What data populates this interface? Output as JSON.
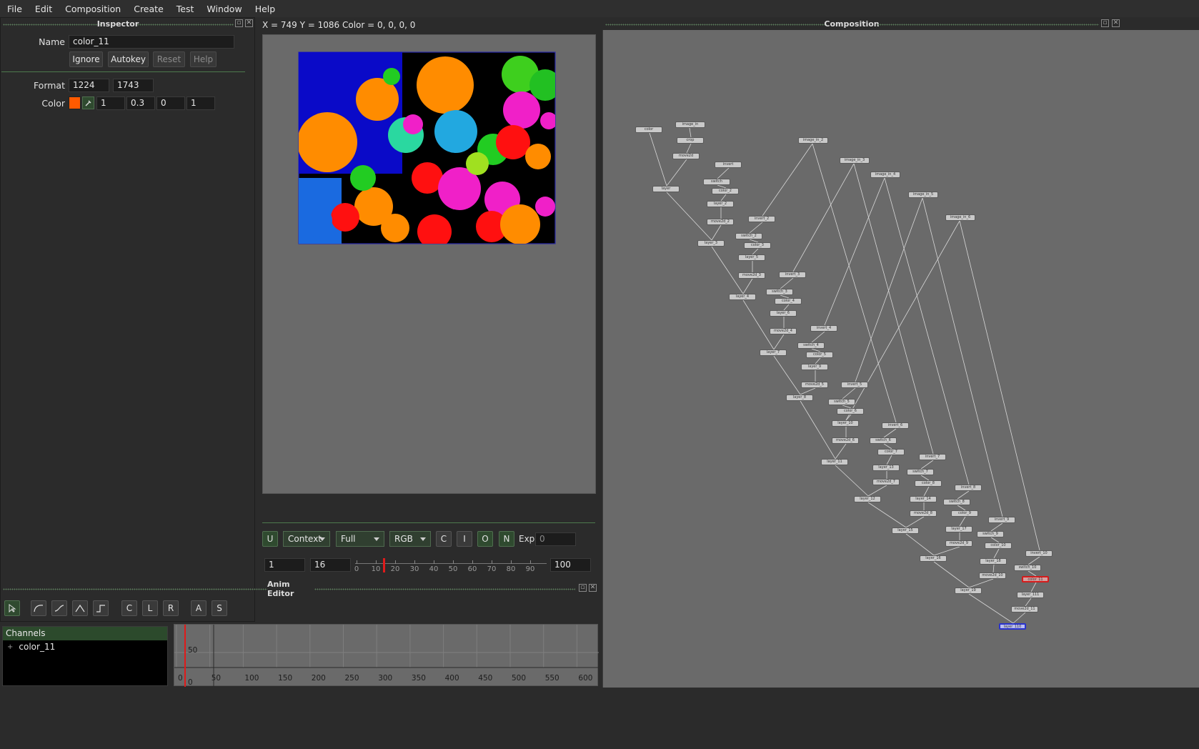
{
  "menu": [
    "File",
    "Edit",
    "Composition",
    "Create",
    "Test",
    "Window",
    "Help"
  ],
  "inspector": {
    "title": "Inspector",
    "name_label": "Name",
    "name_value": "color_11",
    "buttons": {
      "ignore": "Ignore",
      "autokey": "Autokey",
      "reset": "Reset",
      "help": "Help"
    },
    "format_label": "Format",
    "format_w": "1224",
    "format_h": "1743",
    "color_label": "Color",
    "swatch_color": "#ff5a00",
    "color_r": "1",
    "color_g": "0.3",
    "color_b": "0",
    "color_a": "1"
  },
  "viewer": {
    "coords": "X = 749 Y = 1086 Color = 0, 0, 0, 0",
    "toolbar": {
      "u": "U",
      "context": "Context",
      "full": "Full",
      "rgb": "RGB",
      "c": "C",
      "i": "I",
      "o": "O",
      "n": "N",
      "exp_label": "Exp",
      "exp_value": "0"
    },
    "timeline": {
      "start": "1",
      "current": "16",
      "end": "100",
      "ticks": [
        "0",
        "10",
        "20",
        "30",
        "40",
        "50",
        "60",
        "70",
        "80",
        "90"
      ]
    }
  },
  "composition": {
    "title": "Composition",
    "nodes": [
      "color",
      "image_in",
      "crop",
      "move2d",
      "layer",
      "invert",
      "switch",
      "color_2",
      "layer_2",
      "move2d_2",
      "layer_3",
      "image_in_2",
      "image_in_3",
      "image_in_4",
      "image_in_5",
      "image_in_6",
      "invert_2",
      "switch_2",
      "color_3",
      "layer_5",
      "move2d_3",
      "layer_4",
      "invert_3",
      "switch_3",
      "color_4",
      "layer_6",
      "move2d_4",
      "layer_7",
      "invert_4",
      "switch_4",
      "color_5",
      "layer_9",
      "move2d_5",
      "layer_8",
      "invert_5",
      "switch_5",
      "color_6",
      "layer_10",
      "move2d_6",
      "layer_11",
      "invert_6",
      "switch_6",
      "color_7",
      "layer_13",
      "move2d_7",
      "layer_12",
      "invert_7",
      "switch_7",
      "color_8",
      "layer_14",
      "move2d_8",
      "layer_15",
      "invert_8",
      "switch_8",
      "color_9",
      "layer_17",
      "move2d_9",
      "layer_16",
      "invert_9",
      "switch_9",
      "color_10",
      "layer_18",
      "move2d_10",
      "layer_19",
      "invert_10",
      "switch_10",
      "color_11",
      "layer_111",
      "move2d_11",
      "layer_110"
    ]
  },
  "anim": {
    "title": "Anim Editor",
    "tools": {
      "c": "C",
      "l": "L",
      "r": "R",
      "a": "A",
      "s": "S"
    },
    "channels_header": "Channels",
    "channel_item": "color_11",
    "y_labels": [
      "50",
      "0"
    ],
    "x_ticks": [
      "0",
      "50",
      "100",
      "150",
      "200",
      "250",
      "300",
      "350",
      "400",
      "450",
      "500",
      "550",
      "600"
    ]
  }
}
